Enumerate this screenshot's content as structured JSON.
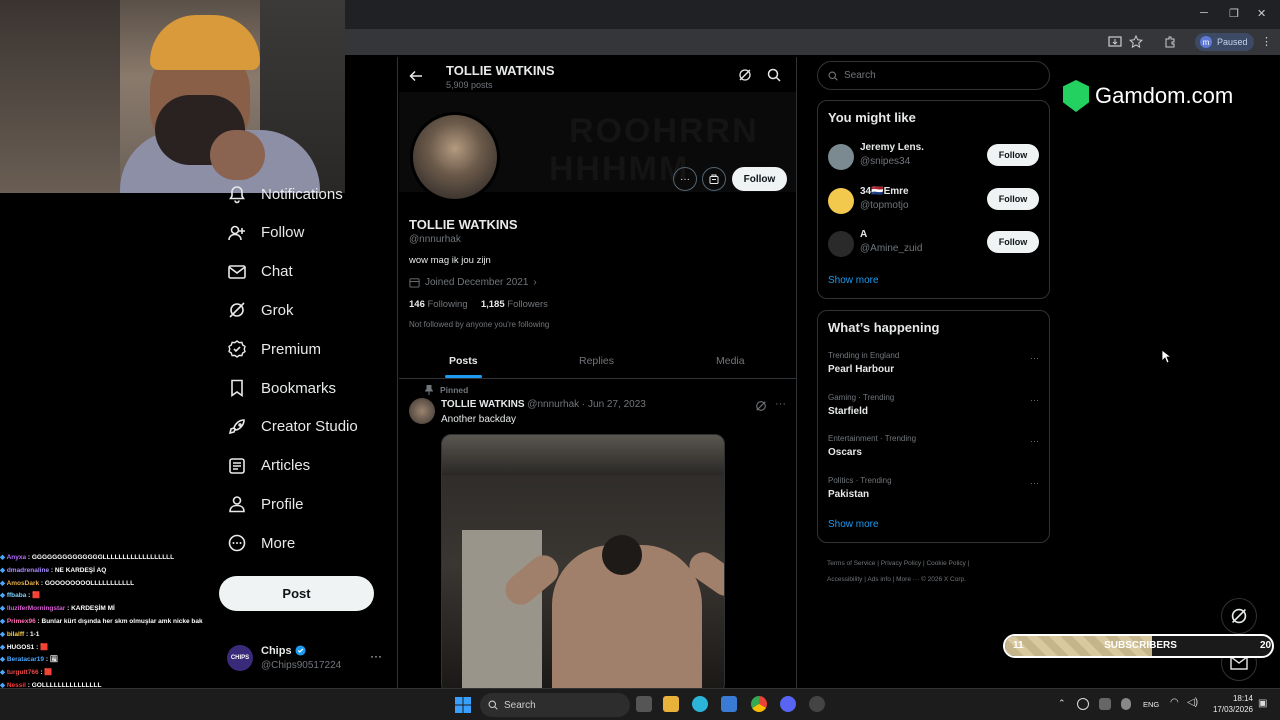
{
  "browser": {
    "paused_label": "Paused",
    "profile_initial": "m"
  },
  "nav": {
    "items": [
      {
        "label": "Notifications",
        "icon": "bell-icon"
      },
      {
        "label": "Follow",
        "icon": "person-plus-icon"
      },
      {
        "label": "Chat",
        "icon": "envelope-icon"
      },
      {
        "label": "Grok",
        "icon": "grok-icon"
      },
      {
        "label": "Premium",
        "icon": "verified-icon"
      },
      {
        "label": "Bookmarks",
        "icon": "bookmark-icon"
      },
      {
        "label": "Creator Studio",
        "icon": "rocket-icon"
      },
      {
        "label": "Articles",
        "icon": "article-icon"
      },
      {
        "label": "Profile",
        "icon": "person-icon"
      },
      {
        "label": "More",
        "icon": "more-circle-icon"
      }
    ],
    "post_label": "Post",
    "account": {
      "name": "Chips",
      "handle": "@Chips90517224",
      "avatar_text": "CHIPS"
    }
  },
  "chat": [
    {
      "user": "Anyxa",
      "msg": "GGGGGGGGGGGGGGLLLLLLLLLLLLLLLLLL",
      "color": "#b36bff"
    },
    {
      "user": "dmadrenaline",
      "msg": "NE KARDEŞİ AQ",
      "color": "#a98bff"
    },
    {
      "user": "AmosDark",
      "msg": "GOOOOOOOOLLLLLLLLLLL",
      "color": "#e8b04a"
    },
    {
      "user": "ffbaba",
      "msg": "🟥",
      "color": "#7fd1ff"
    },
    {
      "user": "lluziferMorningstar",
      "msg": "KARDEŞİM Mİ",
      "color": "#d65bd0"
    },
    {
      "user": "Primex96",
      "msg": "Bunlar kürt dışında her skm olmuşlar amk nicke bak",
      "color": "#ff6fb5"
    },
    {
      "user": "bilalff",
      "msg": "1-1",
      "color": "#ffd24a"
    },
    {
      "user": "HUGOS1",
      "msg": "🟥",
      "color": "#ffffff"
    },
    {
      "user": "Beratacar19",
      "msg": "🖼",
      "color": "#4aa8ff"
    },
    {
      "user": "turgutt766",
      "msg": "🟥",
      "color": "#e84a4a"
    },
    {
      "user": "Nessil",
      "msg": "GOLLLLLLLLLLLLLLL",
      "color": "#ff3b3b"
    }
  ],
  "profile": {
    "header_name": "TOLLIE WATKINS",
    "header_posts": "5,909 posts",
    "name": "TOLLIE WATKINS",
    "handle": "@nnnurhak",
    "bio": "wow mag ik jou zijn",
    "joined": "Joined December 2021",
    "following_count": "146",
    "following_label": "Following",
    "followers_count": "1,185",
    "followers_label": "Followers",
    "note": "Not followed by anyone you're following",
    "follow_label": "Follow",
    "tabs": [
      "Posts",
      "Replies",
      "Media"
    ]
  },
  "post": {
    "pinned": "Pinned",
    "author": "TOLLIE WATKINS",
    "meta": "@nnnurhak · Jun 27, 2023",
    "text": "Another backday"
  },
  "sidebar": {
    "search_placeholder": "Search",
    "you_might_like": {
      "title": "You might like",
      "people": [
        {
          "name": "Jeremy Lens.",
          "handle": "@snipes34",
          "follow": "Follow",
          "color": "#7a8a90"
        },
        {
          "name": "34🇳🇱Emre",
          "handle": "@topmotjo",
          "follow": "Follow",
          "color": "#f2c94c"
        },
        {
          "name": "A",
          "handle": "@Amine_zuid",
          "follow": "Follow",
          "color": "#2a2a2a"
        }
      ],
      "show_more": "Show more"
    },
    "whats_happening": {
      "title": "What’s happening",
      "trends": [
        {
          "context": "Trending in England",
          "name": "Pearl Harbour"
        },
        {
          "context": "Gaming · Trending",
          "name": "Starfield"
        },
        {
          "context": "Entertainment · Trending",
          "name": "Oscars"
        },
        {
          "context": "Politics · Trending",
          "name": "Pakistan"
        }
      ],
      "show_more": "Show more"
    },
    "footer_line1": "Terms of Service  |  Privacy Policy  |  Cookie Policy  |",
    "footer_line2": "Accessibility  |  Ads info  |  More ···  © 2026 X Corp."
  },
  "overlay": {
    "brand": "Gamdom.com",
    "subs_label": "SUBSCRIBERS",
    "subs_current": "11",
    "subs_goal": "20",
    "subs_fraction": 0.55
  },
  "taskbar": {
    "search": "Search",
    "lang": "ENG",
    "time": "18:14",
    "date": "17/03/2026"
  }
}
